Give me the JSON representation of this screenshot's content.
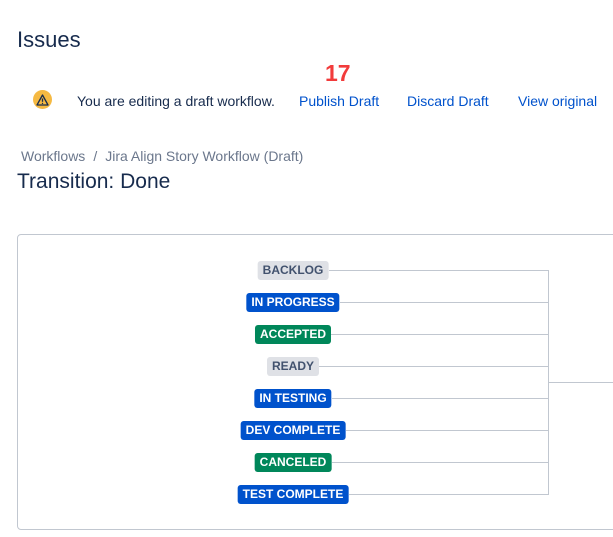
{
  "header": {
    "title": "Issues",
    "counter": "17"
  },
  "banner": {
    "icon": "warning-icon",
    "message": "You are editing a draft workflow.",
    "publish": "Publish Draft",
    "discard": "Discard Draft",
    "view_original": "View original"
  },
  "breadcrumb": {
    "items": [
      "Workflows",
      "Jira Align Story Workflow (Draft)"
    ],
    "separator": "/"
  },
  "page_title": "Transition: Done",
  "colors": {
    "grey": "#dfe1e6",
    "blue": "#0052cc",
    "green": "#00875a"
  },
  "statuses": [
    {
      "label": "BACKLOG",
      "category": "grey"
    },
    {
      "label": "IN PROGRESS",
      "category": "blue"
    },
    {
      "label": "ACCEPTED",
      "category": "green"
    },
    {
      "label": "READY",
      "category": "grey"
    },
    {
      "label": "IN TESTING",
      "category": "blue"
    },
    {
      "label": "DEV COMPLETE",
      "category": "blue"
    },
    {
      "label": "CANCELED",
      "category": "green"
    },
    {
      "label": "TEST COMPLETE",
      "category": "blue"
    }
  ]
}
